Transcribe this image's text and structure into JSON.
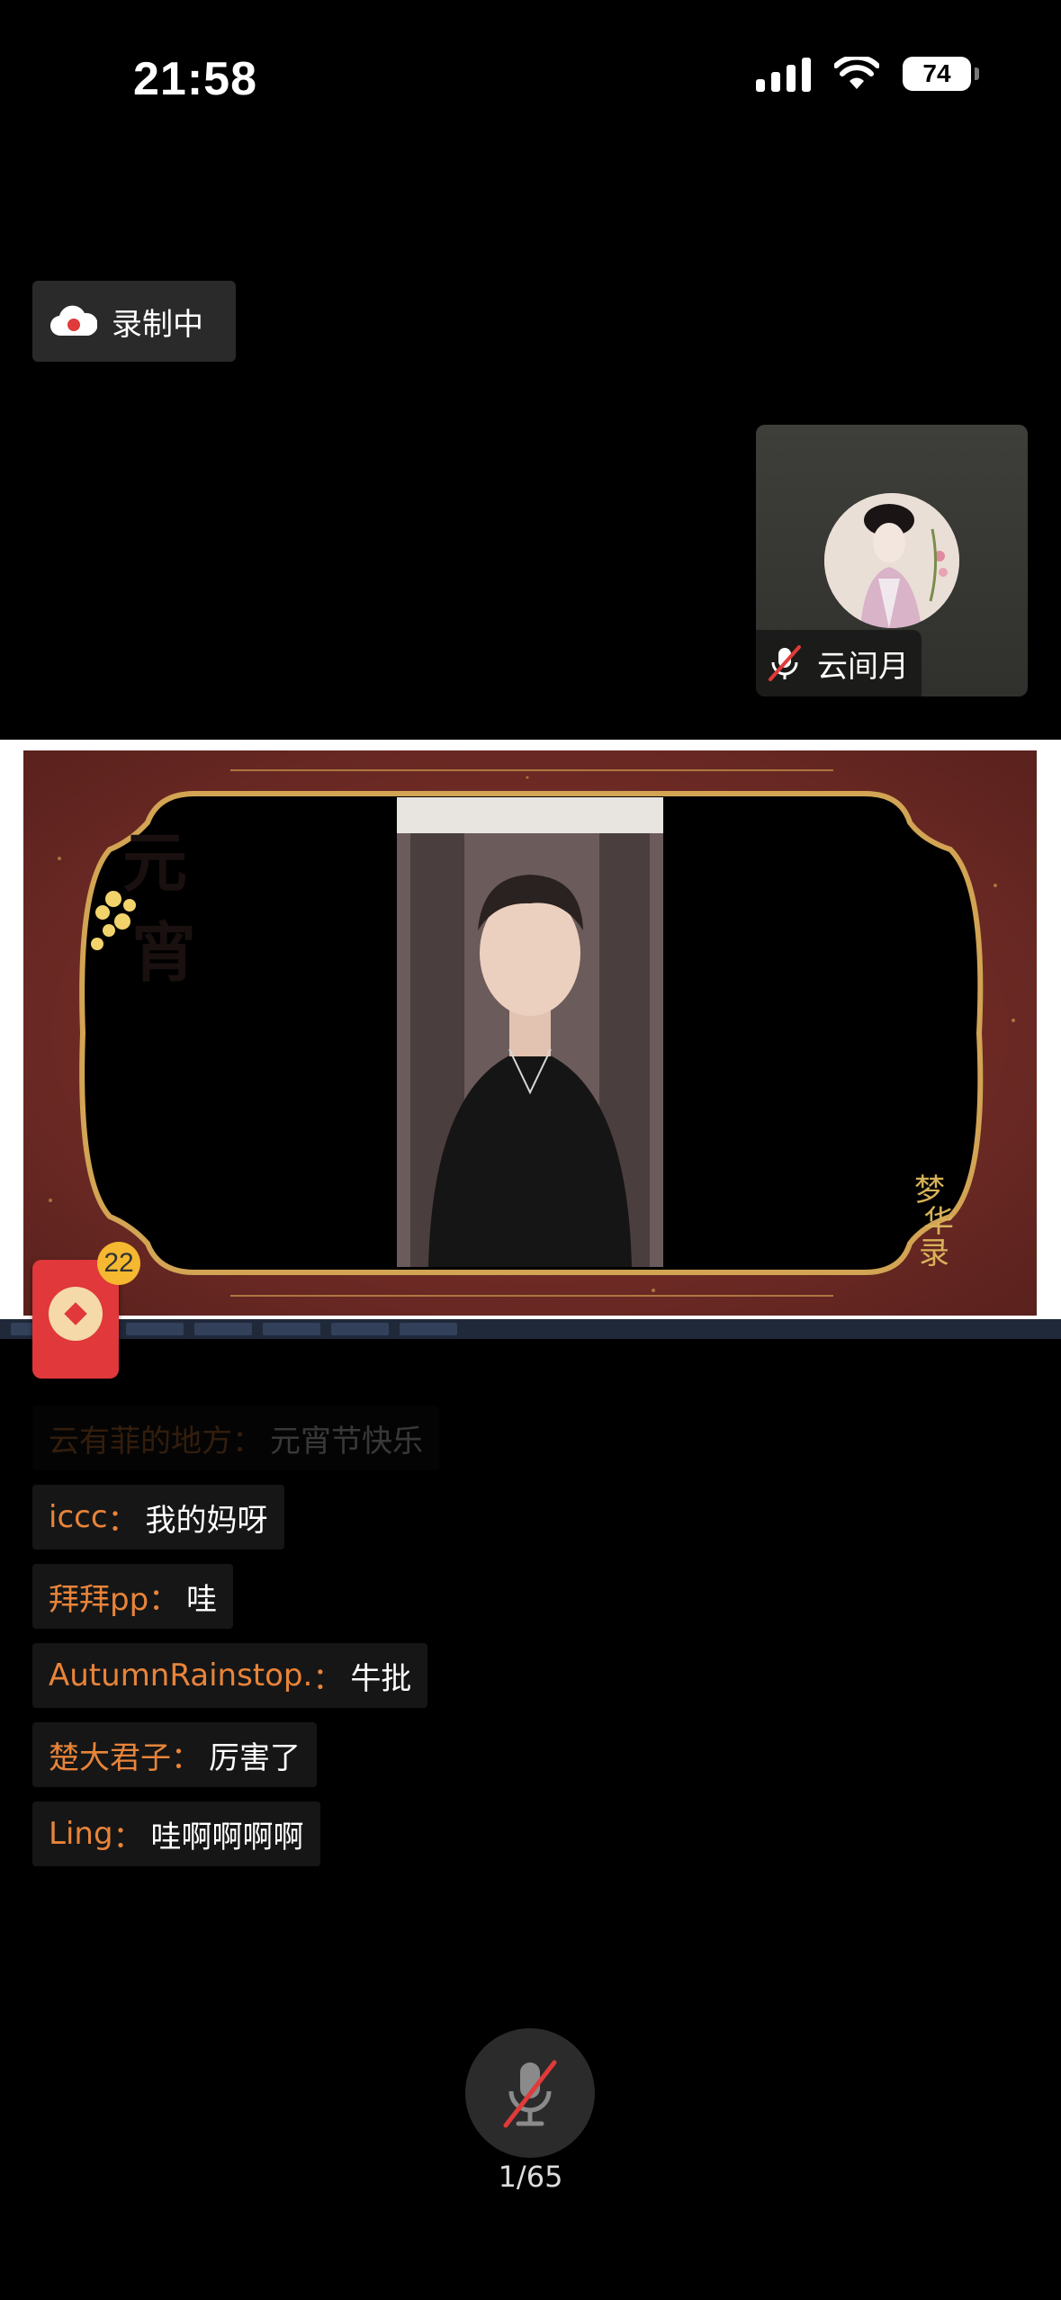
{
  "status_bar": {
    "time": "21:58",
    "battery": "74"
  },
  "recording": {
    "label": "录制中"
  },
  "participant": {
    "name": "云间月"
  },
  "shared_screen": {
    "slide_text_left": "元宵",
    "slide_text_right": "梦华录"
  },
  "red_packet": {
    "count": "22"
  },
  "chat": [
    {
      "user": "云有菲的地方",
      "sep": "：",
      "msg": "元宵节快乐"
    },
    {
      "user": "iccc",
      "sep": "：",
      "msg": "我的妈呀"
    },
    {
      "user": "拜拜pp",
      "sep": "：",
      "msg": "哇"
    },
    {
      "user": "AutumnRainstop.",
      "sep": "：",
      "msg": "牛批"
    },
    {
      "user": "楚大君子",
      "sep": "：",
      "msg": "厉害了"
    },
    {
      "user": "Ling",
      "sep": "：",
      "msg": "哇啊啊啊啊"
    }
  ],
  "mic": {
    "count": "1/65"
  }
}
